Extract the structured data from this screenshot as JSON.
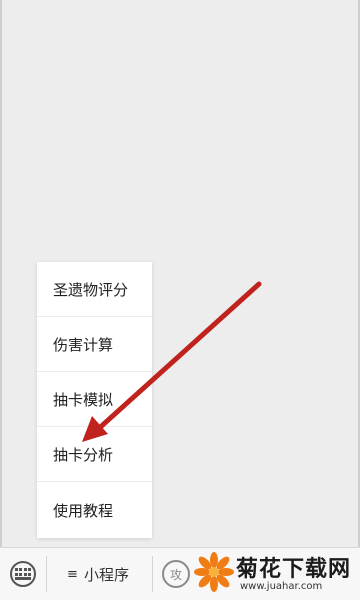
{
  "popup_menu": {
    "items": [
      {
        "label": "圣遗物评分"
      },
      {
        "label": "伤害计算"
      },
      {
        "label": "抽卡模拟"
      },
      {
        "label": "抽卡分析"
      },
      {
        "label": "使用教程"
      }
    ]
  },
  "bottom_bar": {
    "keyboard_icon": "keyboard-icon",
    "mini_program": {
      "icon": "menu-icon",
      "label": "小程序"
    },
    "partial_tab": {
      "label": "攻"
    }
  },
  "annotation": {
    "color": "#c0231e",
    "points_to": "抽卡分析"
  },
  "watermark": {
    "title": "菊花下载网",
    "url": "www.juahar.com",
    "accent": "#f07c14"
  }
}
